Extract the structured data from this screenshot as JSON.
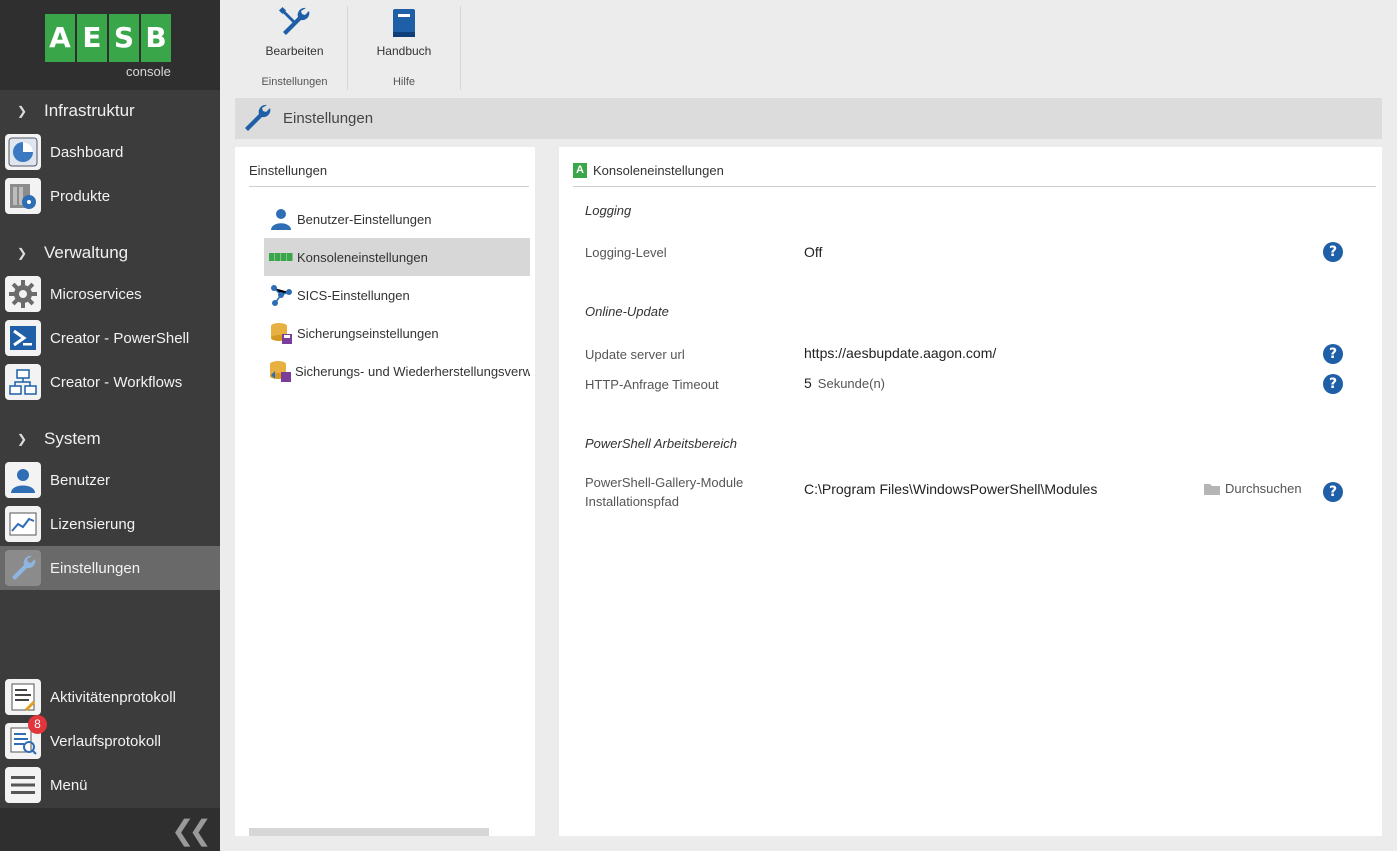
{
  "logo": {
    "letters": [
      "A",
      "E",
      "S",
      "B"
    ],
    "sub": "console"
  },
  "sidebar": {
    "sections": [
      {
        "label": "Infrastruktur"
      },
      {
        "label": "Verwaltung"
      },
      {
        "label": "System"
      }
    ],
    "items": [
      {
        "label": "Dashboard"
      },
      {
        "label": "Produkte"
      },
      {
        "label": "Microservices"
      },
      {
        "label": "Creator - PowerShell"
      },
      {
        "label": "Creator - Workflows"
      },
      {
        "label": "Benutzer"
      },
      {
        "label": "Lizensierung"
      },
      {
        "label": "Einstellungen"
      },
      {
        "label": "Aktivitätenprotokoll"
      },
      {
        "label": "Verlaufsprotokoll",
        "badge": "8"
      },
      {
        "label": "Menü"
      }
    ]
  },
  "ribbon": {
    "groups": [
      {
        "button": "Bearbeiten",
        "group": "Einstellungen"
      },
      {
        "button": "Handbuch",
        "group": "Hilfe"
      }
    ]
  },
  "page": {
    "title": "Einstellungen"
  },
  "left_panel": {
    "header": "Einstellungen",
    "items": [
      {
        "label": "Benutzer-Einstellungen"
      },
      {
        "label": "Konsoleneinstellungen"
      },
      {
        "label": "SICS-Einstellungen"
      },
      {
        "label": "Sicherungseinstellungen"
      },
      {
        "label": "Sicherungs- und Wiederherstellungsverwaltung"
      }
    ]
  },
  "right_panel": {
    "header": "Konsoleneinstellungen",
    "header_badge": "A",
    "logging": {
      "group": "Logging",
      "level_label": "Logging-Level",
      "level_value": "Off"
    },
    "update": {
      "group": "Online-Update",
      "url_label": "Update server url",
      "url_value": "https://aesbupdate.aagon.com/",
      "timeout_label": "HTTP-Anfrage Timeout",
      "timeout_value": "5",
      "timeout_unit": "Sekunde(n)"
    },
    "powershell": {
      "group": "PowerShell Arbeitsbereich",
      "path_label_1": "PowerShell-Gallery-Module",
      "path_label_2": "Installationspfad",
      "path_value": "C:\\Program Files\\WindowsPowerShell\\Modules",
      "browse_label": "Durchsuchen"
    },
    "help_glyph": "?"
  },
  "colors": {
    "accent_green": "#3aa64a",
    "help_blue": "#1e5fa8",
    "sidebar_bg": "#3c3c3c",
    "badge_red": "#e2363c"
  }
}
